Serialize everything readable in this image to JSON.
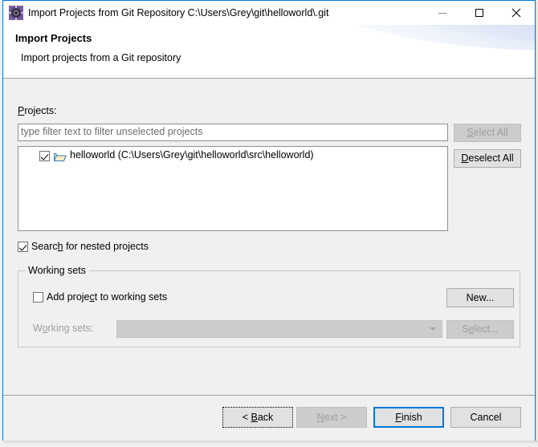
{
  "window": {
    "title": "Import Projects from Git Repository C:\\Users\\Grey\\git\\helloworld\\.git",
    "icon": "eclipse-wizard-icon",
    "controls": {
      "minimize": "minimize-icon",
      "maximize": "maximize-icon",
      "close": "close-icon"
    },
    "accent_color": "#0078d7",
    "background_color": "#f0f0f0"
  },
  "banner": {
    "title": "Import Projects",
    "subtitle": "Import projects from a Git repository"
  },
  "main": {
    "projects_label": "Projects:",
    "projects_label_mnemonic": "P",
    "filter": {
      "value": "",
      "placeholder": "type filter text to filter unselected projects"
    },
    "tree": {
      "items": [
        {
          "checked": true,
          "icon": "open-folder-icon",
          "label": "helloworld (C:\\Users\\Grey\\git\\helloworld\\src\\helloworld)"
        }
      ]
    },
    "select_all": {
      "label": "Select All",
      "mnemonic": "S",
      "enabled": false
    },
    "deselect_all": {
      "label": "Deselect All",
      "mnemonic": "D",
      "enabled": true
    },
    "nested": {
      "label_before": "Searc",
      "label_mnemonic": "h",
      "label_after": " for nested projects",
      "checked": true
    }
  },
  "working_sets": {
    "group_title": "Working sets",
    "add_checkbox": {
      "label_before": "Add proje",
      "label_mnemonic": "c",
      "label_after": "t to working sets",
      "checked": false
    },
    "new_button": {
      "label_before": "New",
      "label_mnemonic": "",
      "label": "New...",
      "enabled": true
    },
    "sets_label": {
      "before": "W",
      "mnemonic": "o",
      "after": "rking sets:",
      "enabled": false
    },
    "combo": {
      "value": "",
      "enabled": false
    },
    "select_button": {
      "label": "Select...",
      "mnemonic": "e",
      "enabled": false
    }
  },
  "footer": {
    "back": {
      "label": "< Back",
      "mnemonic": "B",
      "enabled": true,
      "focused": true
    },
    "next": {
      "label": "Next >",
      "mnemonic": "N",
      "enabled": false
    },
    "finish": {
      "label": "Finish",
      "mnemonic": "F",
      "enabled": true,
      "default": true
    },
    "cancel": {
      "label": "Cancel",
      "enabled": true
    }
  }
}
